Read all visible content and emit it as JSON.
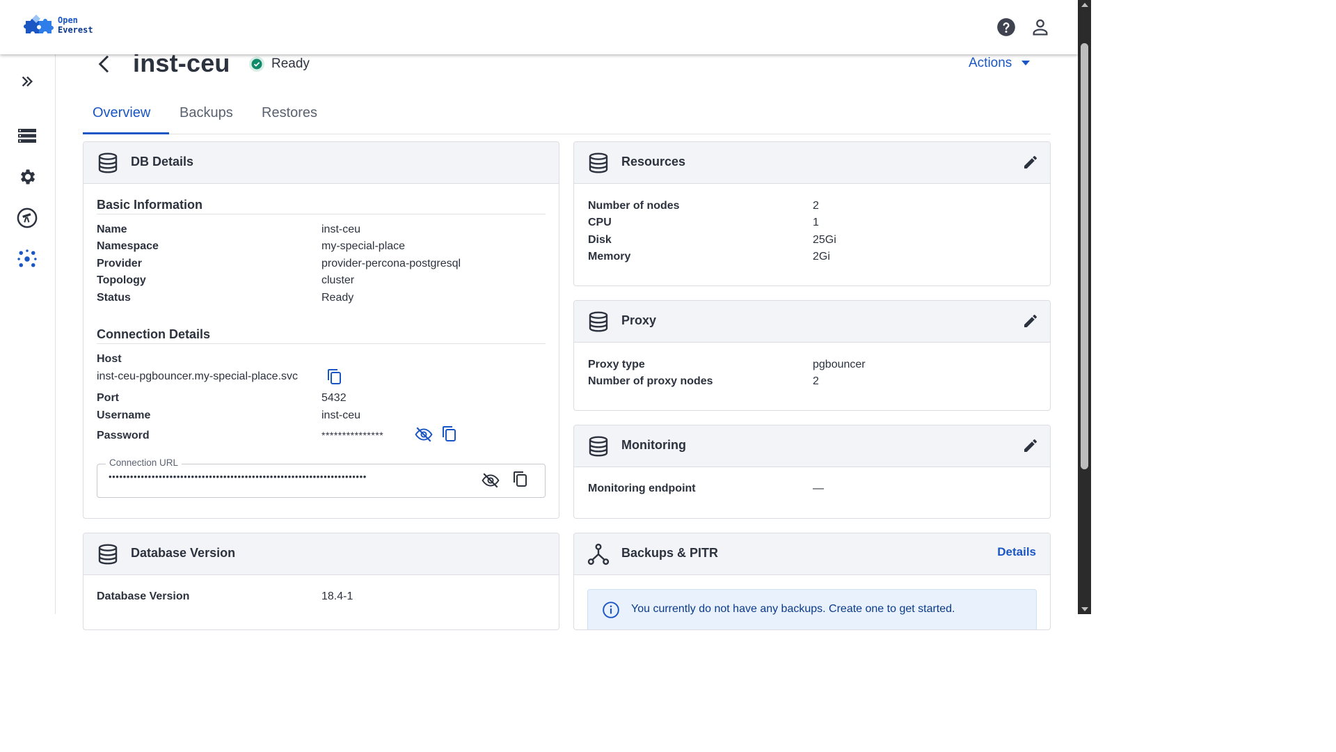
{
  "brand": {
    "line1": "Open",
    "line2": "Everest"
  },
  "appbar": {
    "help_icon": "help-icon",
    "user_icon": "account-icon"
  },
  "nav": [
    {
      "icon": "expand-icon",
      "label": "Expand"
    },
    {
      "icon": "databases-icon",
      "label": "Databases"
    },
    {
      "icon": "settings-icon",
      "label": "Settings"
    },
    {
      "icon": "monitoring-icon",
      "label": "Monitoring"
    },
    {
      "icon": "clusters-icon",
      "label": "Clusters"
    }
  ],
  "header": {
    "db_name": "inst-ceu",
    "status": "Ready",
    "actions_label": "Actions"
  },
  "tabs": [
    {
      "label": "Overview"
    },
    {
      "label": "Backups"
    },
    {
      "label": "Restores"
    }
  ],
  "db_details": {
    "title": "DB Details",
    "basic_title": "Basic Information",
    "basic": [
      {
        "label": "Name",
        "value": "inst-ceu"
      },
      {
        "label": "Namespace",
        "value": "my-special-place"
      },
      {
        "label": "Provider",
        "value": "provider-percona-postgresql"
      },
      {
        "label": "Topology",
        "value": "cluster"
      },
      {
        "label": "Status",
        "value": "Ready"
      }
    ],
    "connection_title": "Connection Details",
    "host_label": "Host",
    "host_value": "inst-ceu-pgbouncer.my-special-place.svc",
    "port_label": "Port",
    "port_value": "5432",
    "username_label": "Username",
    "username_value": "inst-ceu",
    "password_label": "Password",
    "password_value": "***************",
    "url_label": "Connection URL",
    "url_value": "••••••••••••••••••••••••••••••••••••••••••••••••••••••••••••••••••••••••"
  },
  "database_version": {
    "title": "Database Version",
    "label": "Database Version",
    "value": "18.4-1"
  },
  "resources": {
    "title": "Resources",
    "items": [
      {
        "label": "Number of nodes",
        "value": "2"
      },
      {
        "label": "CPU",
        "value": "1"
      },
      {
        "label": "Disk",
        "value": "25Gi"
      },
      {
        "label": "Memory",
        "value": "2Gi"
      }
    ]
  },
  "proxy": {
    "title": "Proxy",
    "items": [
      {
        "label": "Proxy type",
        "value": "pgbouncer"
      },
      {
        "label": "Number of proxy nodes",
        "value": "2"
      }
    ]
  },
  "monitoring": {
    "title": "Monitoring",
    "label": "Monitoring endpoint",
    "value": "—"
  },
  "backups": {
    "title": "Backups & PITR",
    "details_link": "Details",
    "info": "You currently do not have any backups. Create one to get started."
  },
  "colors": {
    "accent": "#1a56c4",
    "text": "#2c323e",
    "status_ok": "#0f8a6a"
  }
}
